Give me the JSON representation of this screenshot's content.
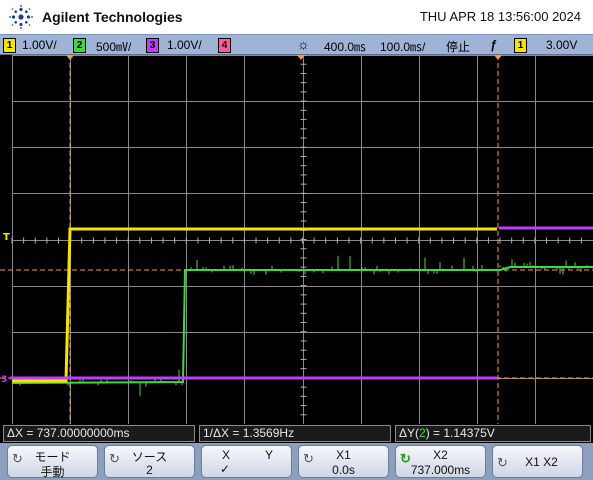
{
  "header": {
    "brand": "Agilent Technologies",
    "datetime": "THU APR 18 13:56:00 2024"
  },
  "status_bar": {
    "channels": [
      {
        "number": "1",
        "scale": "1.00V/",
        "color": "#f5e400"
      },
      {
        "number": "2",
        "scale": "500㎷/",
        "color": "#3fd83f"
      },
      {
        "number": "3",
        "scale": "1.00V/",
        "color": "#c03cff"
      },
      {
        "number": "4",
        "scale": "",
        "color": "#ff5a9b"
      }
    ],
    "time_reference": "400.0㎳",
    "time_scale": "100.0㎳/",
    "run_state": "停止",
    "trigger_icon": "rising-edge-icon",
    "trigger_channel": "1",
    "trigger_level": "3.00V"
  },
  "measurements": {
    "delta_x": "ΔX = 737.00000000ms",
    "inv_delta_x": "1/ΔX = 1.3569Hz",
    "delta_y_prefix": "ΔY(",
    "delta_y_channel": "2",
    "delta_y_suffix": ") = 1.14375V"
  },
  "softkeys": {
    "mode": {
      "label": "モード",
      "value": "手動",
      "icon": "rotary-knob-icon"
    },
    "source": {
      "label": "ソース",
      "value": "2",
      "icon": "rotary-knob-icon"
    },
    "xy": {
      "x_label": "X",
      "y_label": "Y",
      "check": "✓"
    },
    "x1": {
      "label": "X1",
      "value": "0.0s",
      "icon": "rotary-knob-icon"
    },
    "x2": {
      "label": "X2",
      "value": "737.000ms",
      "icon": "active-rotary-knob-icon"
    },
    "x1x2": {
      "label": "X1 X2",
      "icon": "rotary-knob-icon"
    }
  },
  "display": {
    "grid_color": "#8a8a8a",
    "cursor_color": "#ff9a2e",
    "trigger_marker": "T"
  }
}
